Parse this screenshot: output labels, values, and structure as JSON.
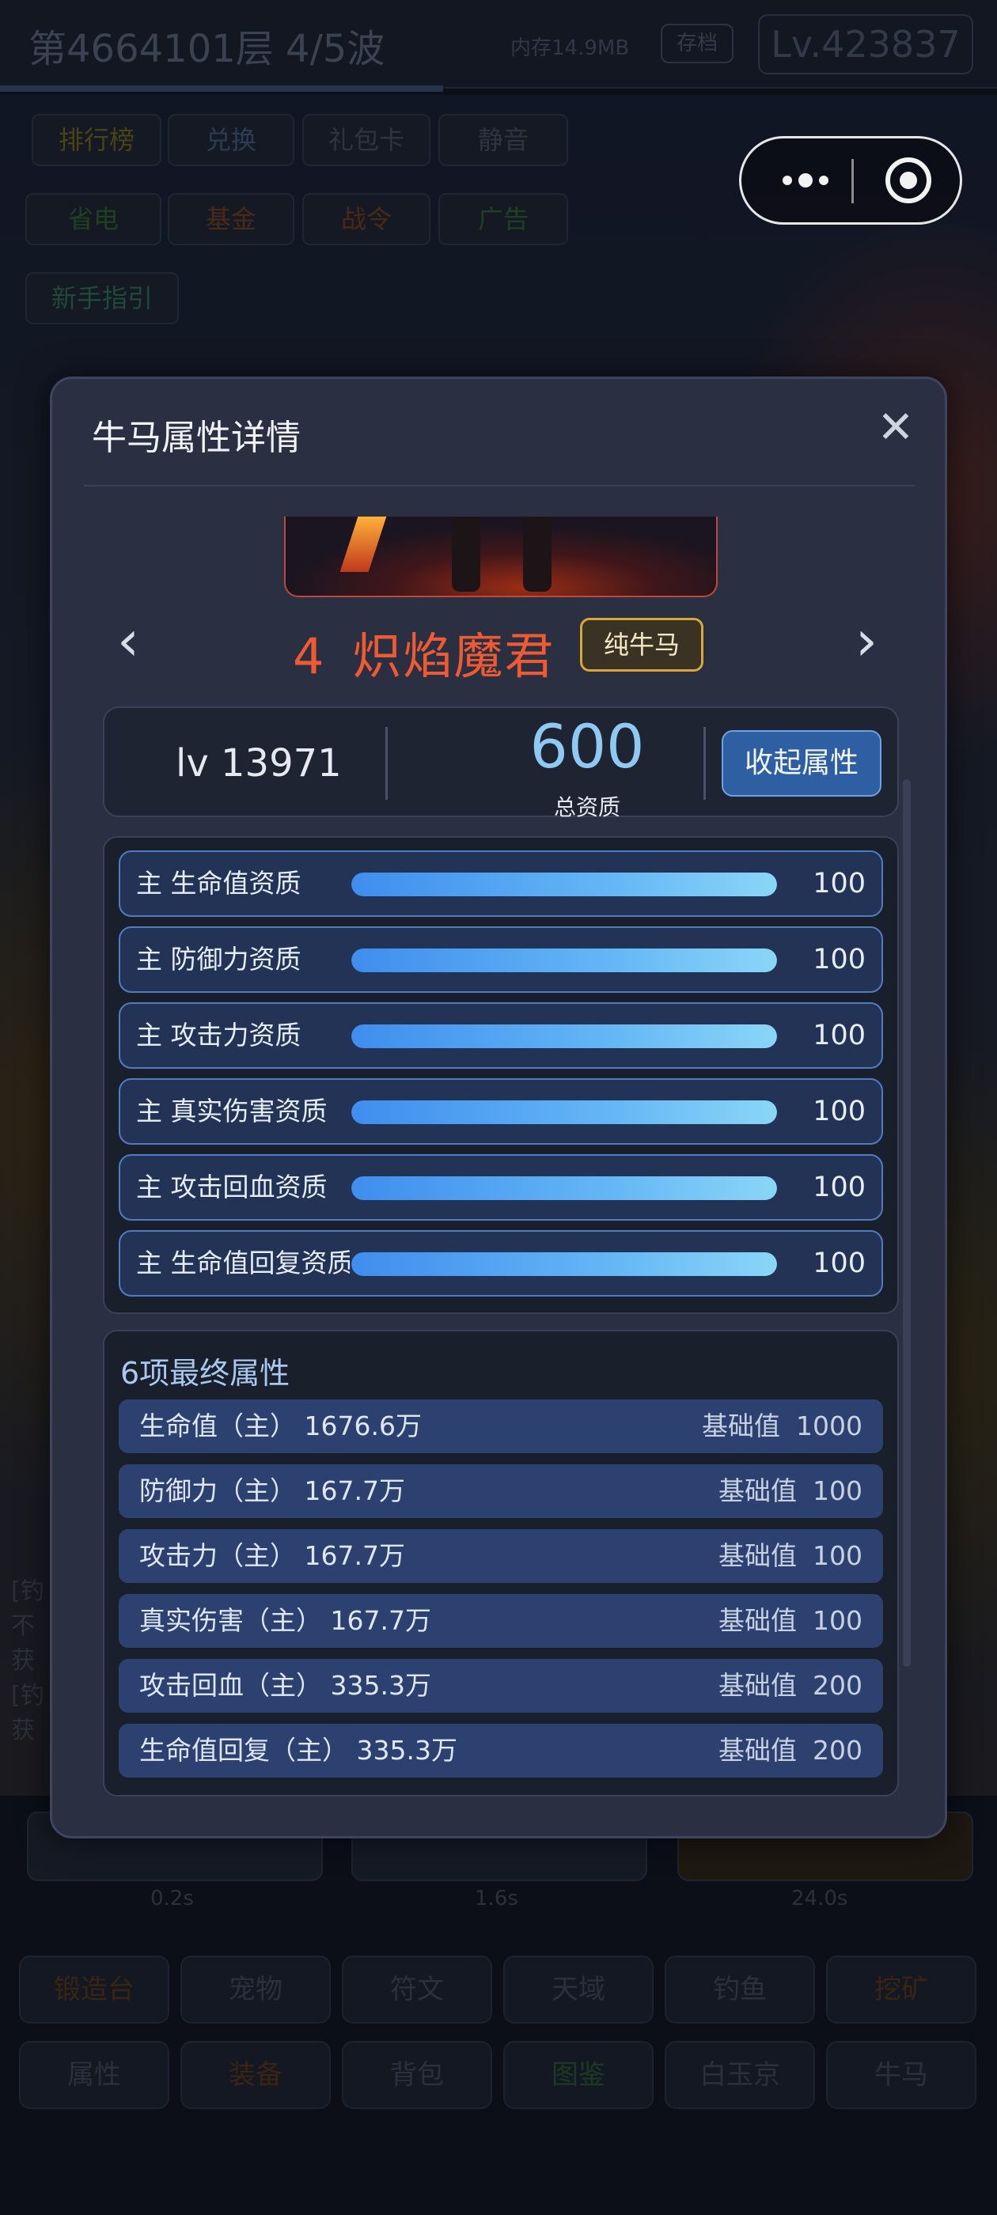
{
  "background": {
    "floor_title": "第4664101层  4/5波",
    "memory": "内存14.9MB",
    "save_label": "存档",
    "level": "Lv.423837",
    "top_buttons": [
      "排行榜",
      "兑换",
      "礼包卡",
      "静音",
      "省电",
      "基金",
      "战令",
      "广告",
      "新手指引"
    ],
    "log_lines": [
      "[钓",
      "不",
      "获",
      "[钓",
      "获"
    ],
    "timers": [
      "0.2s",
      "1.6s",
      "24.0s"
    ],
    "bottom_row1": [
      "锻造台",
      "宠物",
      "符文",
      "天域",
      "钓鱼",
      "挖矿"
    ],
    "bottom_row2": [
      "属性",
      "装备",
      "背包",
      "图鉴",
      "白玉京",
      "牛马"
    ]
  },
  "modal": {
    "title": "牛马属性详情",
    "close_glyph": "✕",
    "hero": {
      "index": "4",
      "name": "炽焰魔君",
      "tag": "纯牛马",
      "prev_glyph": "‹",
      "next_glyph": "›"
    },
    "summary": {
      "level": "lv 13971",
      "total": "600",
      "total_label": "总资质",
      "collapse_label": "收起属性"
    },
    "aptitudes": [
      {
        "label": "主 生命值资质",
        "value": "100",
        "fill": 1.0
      },
      {
        "label": "主 防御力资质",
        "value": "100",
        "fill": 1.0
      },
      {
        "label": "主 攻击力资质",
        "value": "100",
        "fill": 1.0
      },
      {
        "label": "主 真实伤害资质",
        "value": "100",
        "fill": 1.0
      },
      {
        "label": "主 攻击回血资质",
        "value": "100",
        "fill": 1.0
      },
      {
        "label": "主 生命值回复资质",
        "value": "100",
        "fill": 1.0
      }
    ],
    "final_title": "6项最终属性",
    "base_label": "基础值",
    "final_stats": [
      {
        "name": "生命值（主）  1676.6万",
        "base": "1000"
      },
      {
        "name": "防御力（主）  167.7万",
        "base": "100"
      },
      {
        "name": "攻击力（主）  167.7万",
        "base": "100"
      },
      {
        "name": "真实伤害（主）  167.7万",
        "base": "100"
      },
      {
        "name": "攻击回血（主）  335.3万",
        "base": "200"
      },
      {
        "name": "生命值回复（主）  335.3万",
        "base": "200"
      }
    ]
  }
}
